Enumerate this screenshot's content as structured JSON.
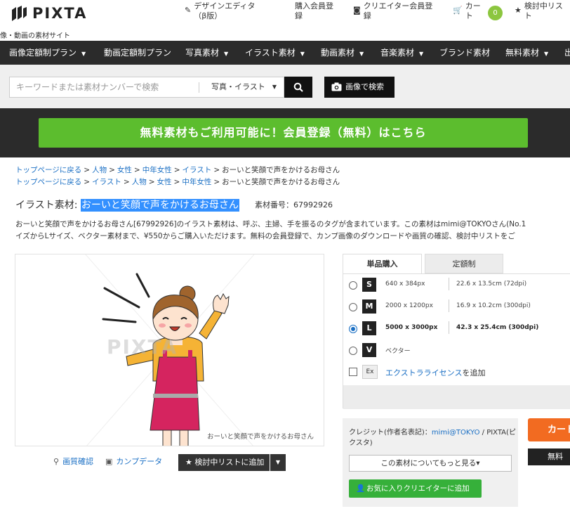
{
  "header": {
    "logo": "PIXTA",
    "tagline": "像・動画の素材サイト",
    "nav": [
      {
        "icon": "pencil-icon",
        "label": "デザインエディタ（β版）"
      },
      {
        "icon": "",
        "label": "購入会員登録"
      },
      {
        "icon": "camera-icon",
        "label": "クリエイター会員登録"
      },
      {
        "icon": "cart-icon",
        "label": "カート"
      },
      {
        "icon": "star-icon",
        "label": "検討中リスト"
      }
    ],
    "cart_count": "0"
  },
  "categories": [
    {
      "label": "画像定額制プラン",
      "dropdown": true
    },
    {
      "label": "動画定額制プラン",
      "dropdown": false
    },
    {
      "label": "写真素材",
      "dropdown": true
    },
    {
      "label": "イラスト素材",
      "dropdown": true
    },
    {
      "label": "動画素材",
      "dropdown": true
    },
    {
      "label": "音楽素材",
      "dropdown": true
    },
    {
      "label": "ブランド素材",
      "dropdown": false
    },
    {
      "label": "無料素材",
      "dropdown": true
    },
    {
      "label": "出",
      "dropdown": false
    }
  ],
  "search": {
    "placeholder": "キーワードまたは素材ナンバーで検索",
    "type": "写真・イラスト",
    "image_search": "画像で検索"
  },
  "promo": "無料素材もご利用可能に！会員登録（無料）はこちら",
  "breadcrumbs": [
    [
      "トップページに戻る",
      "人物",
      "女性",
      "中年女性",
      "イラスト",
      "おーいと笑顔で声をかけるお母さん"
    ],
    [
      "トップページに戻る",
      "イラスト",
      "人物",
      "女性",
      "中年女性",
      "おーいと笑顔で声をかけるお母さん"
    ]
  ],
  "title": {
    "prefix": "イラスト素材: ",
    "name": "おーいと笑顔で声をかけるお母さん",
    "number": "素材番号：67992926"
  },
  "description": [
    "おーいと笑顔で声をかけるお母さん[67992926]のイラスト素材は、呼ぶ、主婦、手を振るのタグが含まれています。この素材はmimi@TOKYOさん(No.1",
    "イズからLサイズ、ベクター素材まで、¥550からご購入いただけます。無料の会員登録で、カンプ画像のダウンロードや画質の確認、検討中リストをご"
  ],
  "preview": {
    "caption": "おーいと笑顔で声をかけるお母さん",
    "watermark": "PIXTA"
  },
  "actions": {
    "quality": "画質確認",
    "comp": "カンプデータ",
    "wishlist": "検討中リストに追加"
  },
  "tabs": [
    "単品購入",
    "定額制"
  ],
  "sizes": [
    {
      "code": "S",
      "px": "640 x 384px",
      "cm": "22.6 x 13.5cm (72dpi)",
      "selected": false
    },
    {
      "code": "M",
      "px": "2000 x 1200px",
      "cm": "16.9 x 10.2cm (300dpi)",
      "selected": false
    },
    {
      "code": "L",
      "px": "5000 x 3000px",
      "cm": "42.3 x 25.4cm (300dpi)",
      "selected": true
    },
    {
      "code": "V",
      "px": "ベクター",
      "cm": "",
      "selected": false
    }
  ],
  "extra_license": {
    "code": "Ex",
    "link": "エクストラライセンス",
    "suffix": "を追加"
  },
  "credit": {
    "label": "クレジット(作者名表記)：",
    "author": "mimi@TOKYO",
    "line2": " / PIXTA(ピクスタ)",
    "more": "この素材についてもっと見る▾",
    "favorite": "お気に入りクリエイターに追加"
  },
  "buy": {
    "cart": "カート",
    "free": "無料"
  },
  "colors": {
    "accent": "#5cbd2e",
    "link": "#1a6fc4",
    "dark": "#2b2b2b",
    "cart": "#f26b21"
  }
}
